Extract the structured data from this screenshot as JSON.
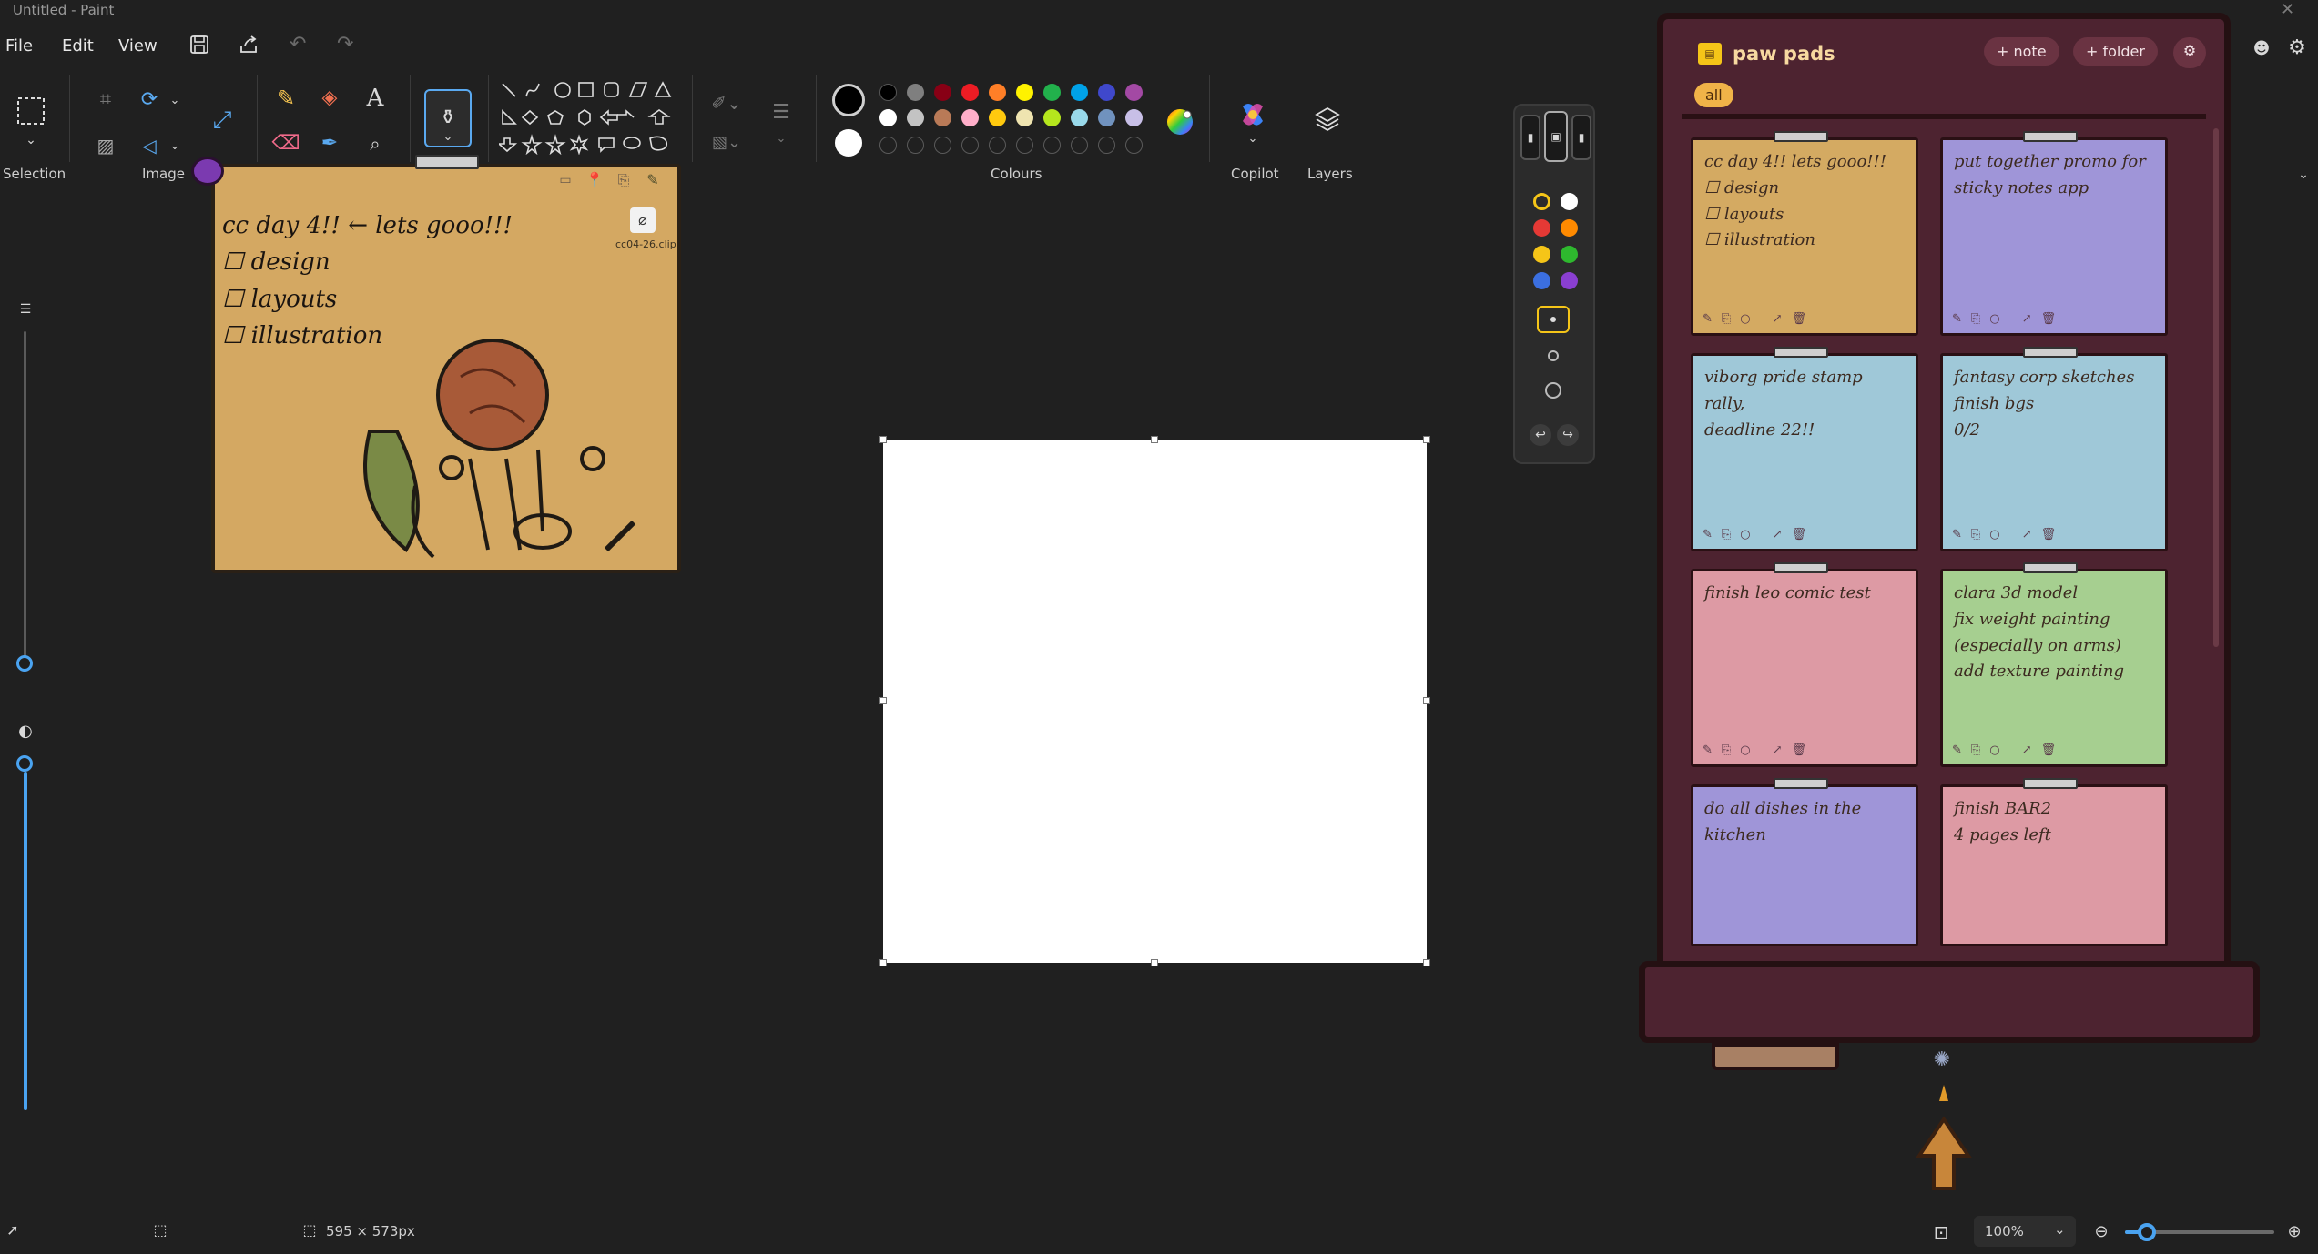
{
  "window": {
    "title": "Untitled - Paint"
  },
  "menu": {
    "file": "File",
    "edit": "Edit",
    "view": "View"
  },
  "ribbon": {
    "groups": {
      "selection": "Selection",
      "image": "Image",
      "colours": "Colours",
      "copilot": "Copilot",
      "layers": "Layers"
    },
    "palette": {
      "row1": [
        "#000000",
        "#7f7f7f",
        "#880015",
        "#ed1c24",
        "#ff7f27",
        "#fff200",
        "#22b14c",
        "#00a2e8",
        "#3f48cc",
        "#a349a4"
      ],
      "row2": [
        "#ffffff",
        "#c3c3c3",
        "#b97a57",
        "#ffaec9",
        "#ffc90e",
        "#efe4b0",
        "#b5e61d",
        "#99d9ea",
        "#7092be",
        "#c8bfe7"
      ],
      "primary": "#000000",
      "secondary": "#ffffff"
    },
    "icons": [
      "selection-icon",
      "crop-icon",
      "rotate-icon",
      "resize-icon",
      "background-removal-icon",
      "flip-icon",
      "pencil-icon",
      "fill-icon",
      "text-icon",
      "eraser-icon",
      "color-picker-icon",
      "magnifier-icon",
      "brush-icon",
      "shapes-icon",
      "outline-icon",
      "fill-style-icon",
      "size-icon",
      "edit-colors-icon",
      "copilot-icon",
      "layers-icon"
    ]
  },
  "note_widget": {
    "attachment": "cc04-26.clip",
    "text_lines": [
      "cc day 4!! ← lets gooo!!!",
      "☐ design",
      "☐ layouts",
      "☐ illustration"
    ]
  },
  "paw_pads": {
    "title": "paw pads",
    "buttons": {
      "note": "+ note",
      "folder": "+ folder",
      "settings": "⚙"
    },
    "filter": "all",
    "cards": [
      {
        "text": "cc day 4!! lets gooo!!!\n☐ design\n☐ layouts\n☐ illustration",
        "color": "#d4aa62"
      },
      {
        "text": "put together promo for\nsticky notes app",
        "color": "#9f95d8"
      },
      {
        "text": "viborg pride stamp rally,\ndeadline 22!!",
        "color": "#9fc8d8"
      },
      {
        "text": "fantasy corp sketches\nfinish bgs\n0/2",
        "color": "#9fc8d8"
      },
      {
        "text": "finish leo comic test",
        "color": "#dd9aa4"
      },
      {
        "text": "clara 3d model\nfix weight painting\n(especially on arms)\nadd texture painting",
        "color": "#a6cf90"
      },
      {
        "text": "do all dishes in the\nkitchen",
        "color": "#9f95d8"
      },
      {
        "text": "finish BAR2\n4 pages left",
        "color": "#dd9aa4"
      }
    ]
  },
  "color_picker": {
    "colors": [
      "#f5c518",
      "#ffffff",
      "#e53935",
      "#ff8a00",
      "#f5c518",
      "#2eb82e",
      "#3b6fe0",
      "#8a3fd1"
    ]
  },
  "status": {
    "canvas_size": "595 × 573px",
    "zoom": "100%"
  }
}
